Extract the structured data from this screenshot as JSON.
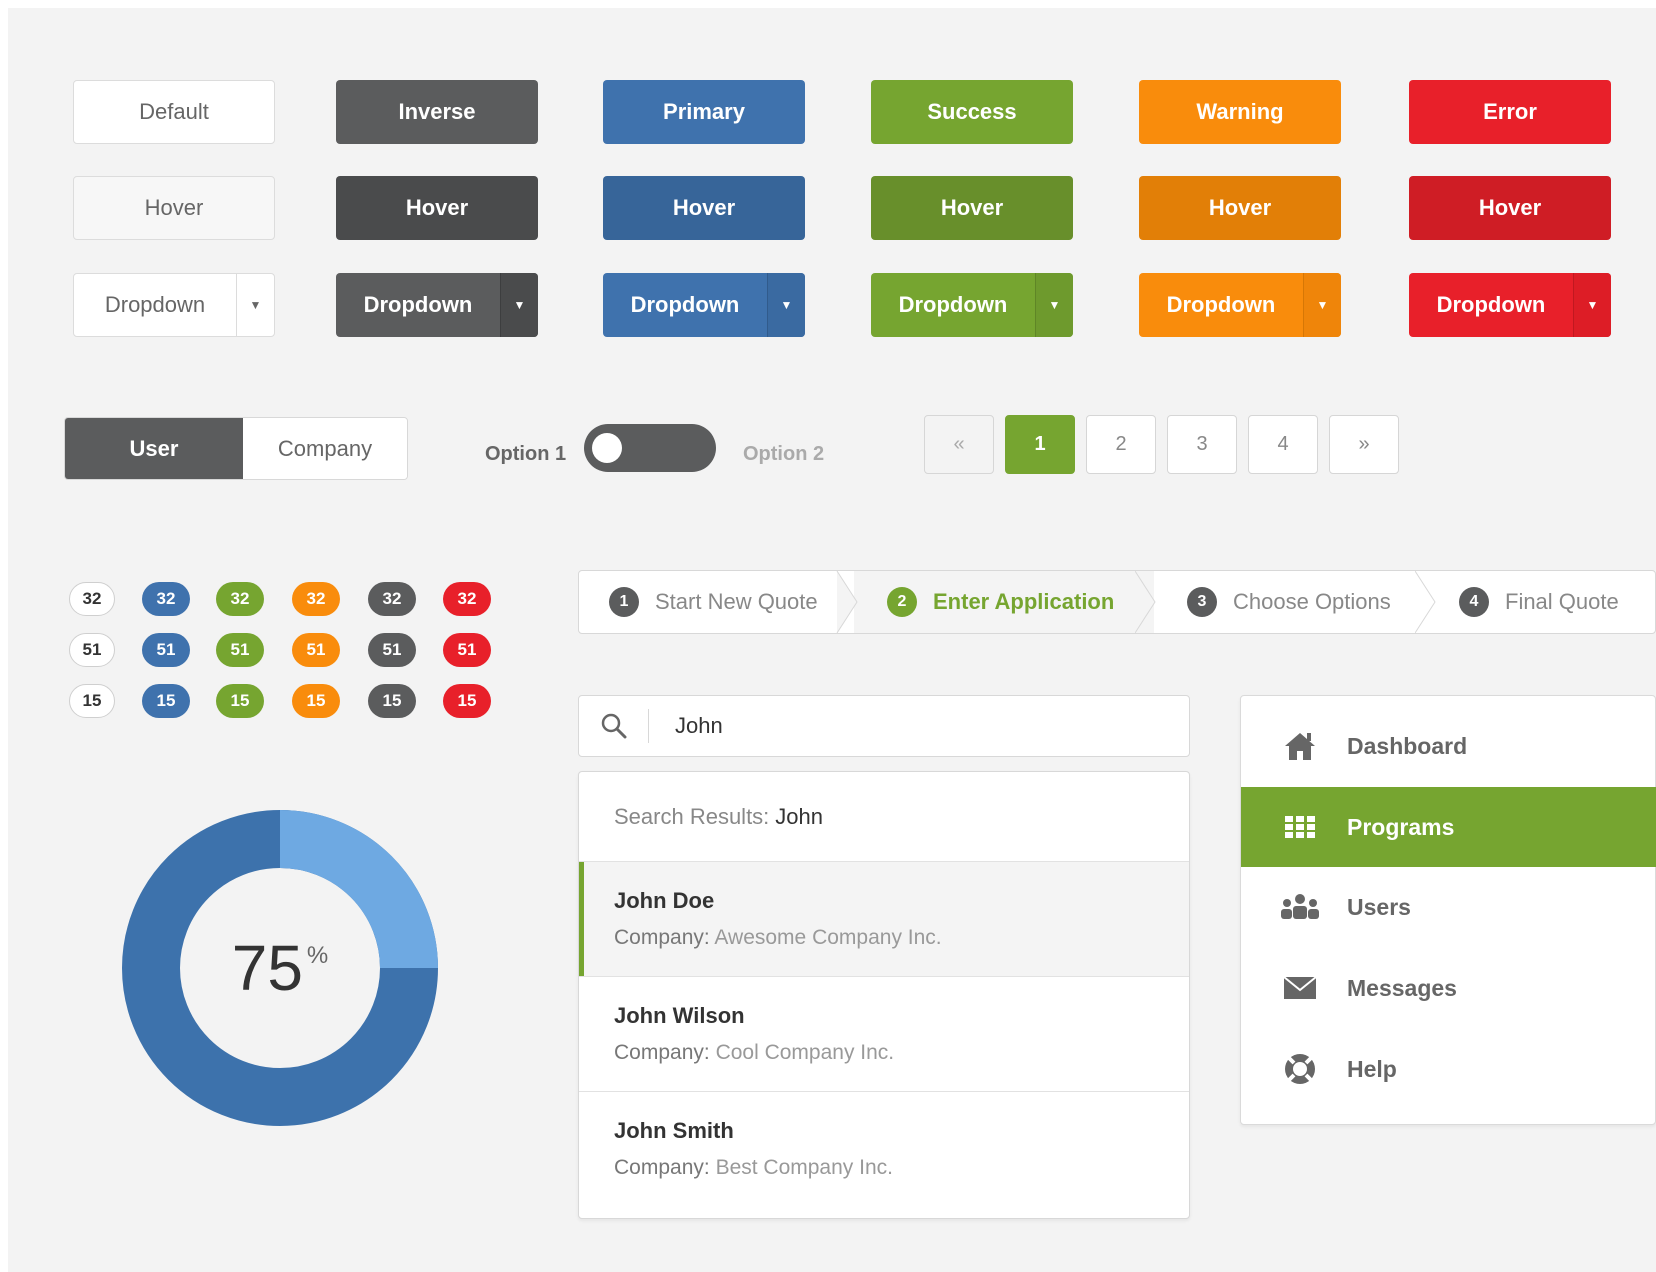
{
  "buttons": {
    "row1": [
      "Default",
      "Inverse",
      "Primary",
      "Success",
      "Warning",
      "Error"
    ],
    "hover_label": "Hover",
    "dropdown_label": "Dropdown"
  },
  "segmented": {
    "left": "User",
    "right": "Company"
  },
  "toggle": {
    "option1": "Option 1",
    "option2": "Option 2"
  },
  "pagination": {
    "prev": "«",
    "pages": [
      "1",
      "2",
      "3",
      "4"
    ],
    "next": "»"
  },
  "badges": {
    "row1": "32",
    "row2": "51",
    "row3": "15"
  },
  "donut": {
    "value": "75",
    "unit": "%",
    "percent": 75
  },
  "steps": [
    {
      "num": "1",
      "label": "Start New Quote"
    },
    {
      "num": "2",
      "label": "Enter Application"
    },
    {
      "num": "3",
      "label": "Choose Options"
    },
    {
      "num": "4",
      "label": "Final Quote"
    }
  ],
  "search": {
    "value": "John"
  },
  "results": {
    "heading": "Search Results:",
    "query": "John",
    "company_key": "Company:",
    "items": [
      {
        "name": "John Doe",
        "company": "Awesome Company Inc."
      },
      {
        "name": "John Wilson",
        "company": "Cool Company Inc."
      },
      {
        "name": "John Smith",
        "company": "Best Company Inc."
      }
    ]
  },
  "nav": {
    "items": [
      {
        "label": "Dashboard",
        "icon": "home-icon"
      },
      {
        "label": "Programs",
        "icon": "grid-icon"
      },
      {
        "label": "Users",
        "icon": "users-icon"
      },
      {
        "label": "Messages",
        "icon": "envelope-icon"
      },
      {
        "label": "Help",
        "icon": "lifebuoy-icon"
      }
    ]
  },
  "colors": {
    "inverse": "#5b5c5d",
    "primary": "#3f72ad",
    "success": "#76a530",
    "warning": "#f98c0c",
    "error": "#e8202a",
    "donut_dark": "#3d72ac",
    "donut_light": "#6ea9e2"
  }
}
